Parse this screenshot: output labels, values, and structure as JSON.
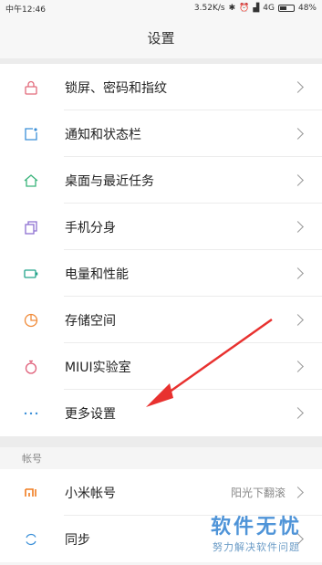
{
  "status": {
    "time": "中午12:46",
    "speed": "3.52K/s",
    "network": "4G",
    "battery": "48%",
    "battery_level": 0.48
  },
  "header": {
    "title": "设置"
  },
  "items": [
    {
      "label": "锁屏、密码和指纹",
      "icon": "lock-icon",
      "color": "#e26a7b"
    },
    {
      "label": "通知和状态栏",
      "icon": "notification-icon",
      "color": "#3a8fd8"
    },
    {
      "label": "桌面与最近任务",
      "icon": "home-icon",
      "color": "#39b37a"
    },
    {
      "label": "手机分身",
      "icon": "clone-icon",
      "color": "#8d6fd1"
    },
    {
      "label": "电量和性能",
      "icon": "battery-icon",
      "color": "#21a38a"
    },
    {
      "label": "存储空间",
      "icon": "storage-icon",
      "color": "#f08b3a"
    },
    {
      "label": "MIUI实验室",
      "icon": "stopwatch-icon",
      "color": "#e0607a"
    },
    {
      "label": "更多设置",
      "icon": "more-icon",
      "color": "#3a8fd8"
    }
  ],
  "account_section": {
    "header": "帐号",
    "items": [
      {
        "label": "小米帐号",
        "value": "阳光下翻滚",
        "icon": "mi-logo-icon",
        "color": "#f07b1e"
      },
      {
        "label": "同步",
        "icon": "sync-icon",
        "color": "#3a8fd8"
      }
    ]
  },
  "watermark": {
    "title": "软件无忧",
    "subtitle": "努力解决软件问题"
  },
  "annotation": {
    "arrow_color": "#e8312f"
  }
}
